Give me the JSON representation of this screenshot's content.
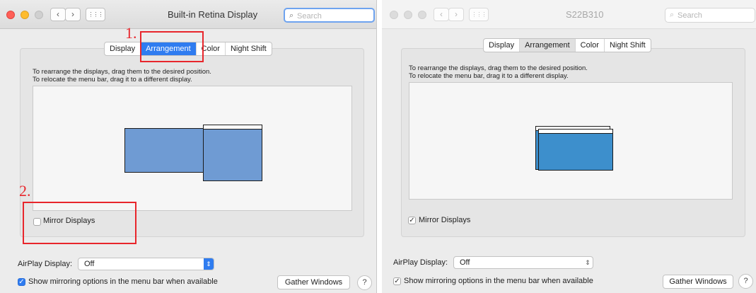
{
  "left_window": {
    "title": "Built-in Retina Display",
    "search_placeholder": "Search",
    "tabs": [
      {
        "label": "Display"
      },
      {
        "label": "Arrangement"
      },
      {
        "label": "Color"
      },
      {
        "label": "Night Shift"
      }
    ],
    "instructions": {
      "line1": "To rearrange the displays, drag them to the desired position.",
      "line2": "To relocate the menu bar, drag it to a different display."
    },
    "mirror_displays": {
      "label": "Mirror Displays",
      "checked": false
    },
    "airplay": {
      "label": "AirPlay Display:",
      "value": "Off"
    },
    "show_mirroring": {
      "label": "Show mirroring options in the menu bar when available",
      "checked": true
    },
    "gather_windows_label": "Gather Windows",
    "help_label": "?",
    "annotations": {
      "step1": "1.",
      "step2": "2."
    }
  },
  "right_window": {
    "title": "S22B310",
    "search_placeholder": "Search",
    "tabs": [
      {
        "label": "Display"
      },
      {
        "label": "Arrangement"
      },
      {
        "label": "Color"
      },
      {
        "label": "Night Shift"
      }
    ],
    "instructions": {
      "line1": "To rearrange the displays, drag them to the desired position.",
      "line2": "To relocate the menu bar, drag it to a different display."
    },
    "mirror_displays": {
      "label": "Mirror Displays",
      "checked": true
    },
    "airplay": {
      "label": "AirPlay Display:",
      "value": "Off"
    },
    "show_mirroring": {
      "label": "Show mirroring options in the menu bar when available",
      "checked": true
    },
    "gather_windows_label": "Gather Windows",
    "help_label": "?"
  },
  "icons": {
    "back": "‹",
    "forward": "›",
    "grid": "⋮⋮⋮",
    "search": "⌕",
    "popup_arrows": "⇕",
    "checkmark": "✓"
  },
  "colors": {
    "accent_blue": "#2f7cf0",
    "display_blue_left": "#6f9bd3",
    "display_blue_right": "#3d8fcc",
    "annotation_red": "#e8262c",
    "close": "#ff5f57",
    "minimize": "#febc2e",
    "zoom_inactive": "#d0d0d0"
  }
}
